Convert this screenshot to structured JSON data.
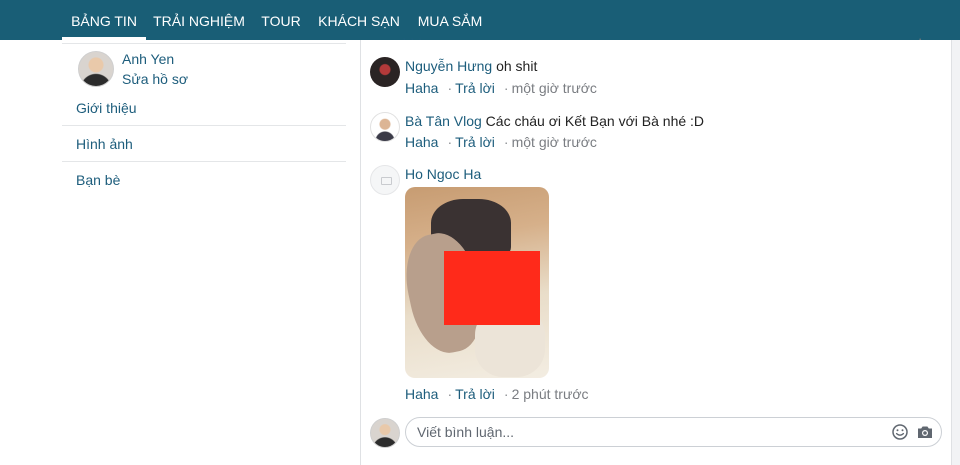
{
  "nav": {
    "tabs": [
      {
        "label": "BẢNG TIN",
        "active": true
      },
      {
        "label": "TRẢI NGHIỆM"
      },
      {
        "label": "TOUR"
      },
      {
        "label": "KHÁCH SẠN"
      },
      {
        "label": "MUA SẮM"
      }
    ]
  },
  "sidebar": {
    "profile": {
      "name": "Anh Yen",
      "edit_label": "Sửa hồ sơ"
    },
    "items": [
      {
        "label": "Giới thiệu"
      },
      {
        "label": "Hình ảnh"
      },
      {
        "label": "Bạn bè"
      }
    ]
  },
  "comments": [
    {
      "author": "Nguyễn Hưng",
      "text": " oh shit",
      "reaction": "Haha",
      "separator": "·",
      "reply": "Trả lời",
      "time": "một giờ trước"
    },
    {
      "author": "Bà Tân Vlog",
      "text": " Các cháu ơi Kết Bạn với Bà nhé :D",
      "reaction": "Haha",
      "separator": "·",
      "reply": "Trả lời",
      "time": "một giờ trước"
    },
    {
      "author": "Ho Ngoc Ha",
      "text": "",
      "reaction": "Haha",
      "separator": "·",
      "reply": "Trả lời",
      "time": "2 phút trước"
    }
  ],
  "composer": {
    "placeholder": "Viết bình luận..."
  },
  "icons": {
    "emoji": "smiley-icon",
    "camera": "camera-icon"
  },
  "colors": {
    "nav_bg": "#195e76",
    "link": "#1d5d7c",
    "redaction": "#ff2a1a"
  }
}
